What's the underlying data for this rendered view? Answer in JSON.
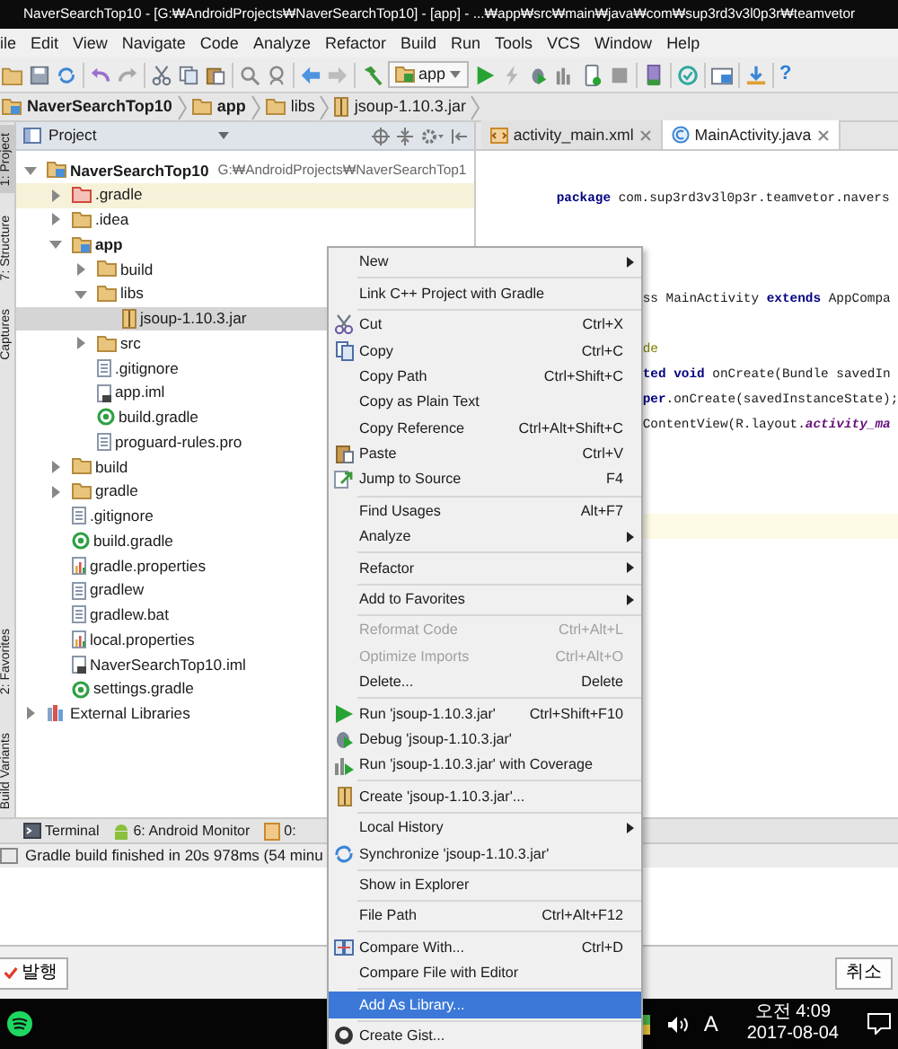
{
  "window": {
    "title": "NaverSearchTop10 - [G:₩AndroidProjects₩NaverSearchTop10] - [app] - ...₩app₩src₩main₩java₩com₩sup3rd3v3l0p3r₩teamvetor"
  },
  "menu_bar": [
    "ile",
    "Edit",
    "View",
    "Navigate",
    "Code",
    "Analyze",
    "Refactor",
    "Build",
    "Run",
    "Tools",
    "VCS",
    "Window",
    "Help"
  ],
  "toolbar": {
    "run_config": "app",
    "help": "?"
  },
  "breadcrumb": [
    "NaverSearchTop10",
    "app",
    "libs",
    "jsoup-1.10.3.jar"
  ],
  "side_tabs": [
    {
      "label": "1: Project",
      "selected": true
    },
    {
      "label": "7: Structure",
      "selected": false
    },
    {
      "label": "Captures",
      "selected": false
    },
    {
      "label": "2: Favorites",
      "selected": false
    },
    {
      "label": "Build Variants",
      "selected": false
    }
  ],
  "project_panel": {
    "view": "Project",
    "tree": [
      {
        "label": "NaverSearchTop10",
        "path": "G:₩AndroidProjects₩NaverSearchTop1",
        "kind": "module",
        "expanded": true,
        "selected": false,
        "highlighted": false,
        "children": [
          {
            "label": ".gradle",
            "kind": "excluded_folder",
            "expanded": false,
            "selected": false,
            "highlighted": true
          },
          {
            "label": ".idea",
            "kind": "folder",
            "expanded": false,
            "selected": false,
            "highlighted": false
          },
          {
            "label": "app",
            "kind": "module",
            "expanded": true,
            "selected": false,
            "highlighted": false,
            "children": [
              {
                "label": "build",
                "kind": "folder",
                "expanded": false,
                "selected": false,
                "highlighted": false
              },
              {
                "label": "libs",
                "kind": "folder",
                "expanded": true,
                "selected": false,
                "highlighted": false,
                "children": [
                  {
                    "label": "jsoup-1.10.3.jar",
                    "kind": "jar",
                    "selected": true,
                    "highlighted": false
                  }
                ]
              },
              {
                "label": "src",
                "kind": "folder",
                "expanded": false,
                "selected": false,
                "highlighted": false
              },
              {
                "label": ".gitignore",
                "kind": "text",
                "selected": false,
                "highlighted": false
              },
              {
                "label": "app.iml",
                "kind": "iml",
                "selected": false,
                "highlighted": false
              },
              {
                "label": "build.gradle",
                "kind": "gradle",
                "selected": false,
                "highlighted": false
              },
              {
                "label": "proguard-rules.pro",
                "kind": "text",
                "selected": false,
                "highlighted": false
              }
            ]
          },
          {
            "label": "build",
            "kind": "folder",
            "expanded": false,
            "selected": false,
            "highlighted": false
          },
          {
            "label": "gradle",
            "kind": "folder",
            "expanded": false,
            "selected": false,
            "highlighted": false
          },
          {
            "label": ".gitignore",
            "kind": "text",
            "selected": false,
            "highlighted": false
          },
          {
            "label": "build.gradle",
            "kind": "gradle",
            "selected": false,
            "highlighted": false
          },
          {
            "label": "gradle.properties",
            "kind": "properties",
            "selected": false,
            "highlighted": false
          },
          {
            "label": "gradlew",
            "kind": "text",
            "selected": false,
            "highlighted": false
          },
          {
            "label": "gradlew.bat",
            "kind": "text",
            "selected": false,
            "highlighted": false
          },
          {
            "label": "local.properties",
            "kind": "properties",
            "selected": false,
            "highlighted": false
          },
          {
            "label": "NaverSearchTop10.iml",
            "kind": "iml",
            "selected": false,
            "highlighted": false
          },
          {
            "label": "settings.gradle",
            "kind": "gradle",
            "selected": false,
            "highlighted": false
          }
        ]
      },
      {
        "label": "External Libraries",
        "kind": "libraries",
        "expanded": false,
        "selected": false,
        "highlighted": false
      }
    ]
  },
  "editor": {
    "tabs": [
      {
        "label": "activity_main.xml",
        "kind": "xml",
        "selected": false
      },
      {
        "label": "MainActivity.java",
        "kind": "class",
        "selected": true
      }
    ],
    "lines": [
      {
        "partly_hidden": false,
        "current": false,
        "tokens": [
          {
            "kind": "keyword",
            "text": "package"
          },
          {
            "kind": "plain",
            "text": " com.sup3rd3v3l0p3r.teamvetor.navers"
          }
        ]
      },
      {
        "current": false
      },
      {
        "current": false
      },
      {
        "current": false
      },
      {
        "partly_hidden": true,
        "current": false,
        "tokens": [
          {
            "kind": "plain",
            "text": "ss MainActivity "
          },
          {
            "kind": "keyword",
            "text": "extends"
          },
          {
            "kind": "plain",
            "text": " AppCompa"
          }
        ]
      },
      {
        "current": false
      },
      {
        "partly_hidden": true,
        "current": false,
        "tokens": [
          {
            "kind": "annotation",
            "text": "de"
          }
        ]
      },
      {
        "partly_hidden": true,
        "current": false,
        "tokens": [
          {
            "kind": "keyword",
            "text": "ted void"
          },
          {
            "kind": "plain",
            "text": " onCreate(Bundle savedIn"
          }
        ]
      },
      {
        "partly_hidden": true,
        "current": false,
        "tokens": [
          {
            "kind": "keyword",
            "text": "per"
          },
          {
            "kind": "plain",
            "text": ".onCreate(savedInstanceState);"
          }
        ]
      },
      {
        "partly_hidden": true,
        "current": false,
        "tokens": [
          {
            "kind": "plain",
            "text": "ContentView(R.layout."
          },
          {
            "kind": "field",
            "text": "activity_ma"
          }
        ]
      },
      {
        "current": false
      },
      {
        "current": false
      },
      {
        "current": false
      },
      {
        "current": true
      }
    ]
  },
  "tool_tabs": [
    "Terminal",
    "6: Android Monitor",
    "0:"
  ],
  "status_bar": "Gradle build finished in 20s 978ms (54 minu",
  "context_menu": {
    "items": [
      {
        "kind": "item",
        "label": "New",
        "submenu": true,
        "disabled": false,
        "selected": false
      },
      {
        "kind": "separator"
      },
      {
        "kind": "item",
        "label": "Link C++ Project with Gradle",
        "submenu": false,
        "disabled": false,
        "selected": false
      },
      {
        "kind": "separator"
      },
      {
        "kind": "item",
        "label": "Cut",
        "shortcut": "Ctrl+X",
        "submenu": false,
        "disabled": false,
        "selected": false
      },
      {
        "kind": "item",
        "label": "Copy",
        "shortcut": "Ctrl+C",
        "submenu": false,
        "disabled": false,
        "selected": false
      },
      {
        "kind": "item",
        "label": "Copy Path",
        "shortcut": "Ctrl+Shift+C",
        "submenu": false,
        "disabled": false,
        "selected": false
      },
      {
        "kind": "item",
        "label": "Copy as Plain Text",
        "submenu": false,
        "disabled": false,
        "selected": false
      },
      {
        "kind": "item",
        "label": "Copy Reference",
        "shortcut": "Ctrl+Alt+Shift+C",
        "submenu": false,
        "disabled": false,
        "selected": false
      },
      {
        "kind": "item",
        "label": "Paste",
        "shortcut": "Ctrl+V",
        "submenu": false,
        "disabled": false,
        "selected": false
      },
      {
        "kind": "item",
        "label": "Jump to Source",
        "shortcut": "F4",
        "submenu": false,
        "disabled": false,
        "selected": false
      },
      {
        "kind": "separator"
      },
      {
        "kind": "item",
        "label": "Find Usages",
        "shortcut": "Alt+F7",
        "submenu": false,
        "disabled": false,
        "selected": false
      },
      {
        "kind": "item",
        "label": "Analyze",
        "submenu": true,
        "disabled": false,
        "selected": false
      },
      {
        "kind": "separator"
      },
      {
        "kind": "item",
        "label": "Refactor",
        "submenu": true,
        "disabled": false,
        "selected": false
      },
      {
        "kind": "separator"
      },
      {
        "kind": "item",
        "label": "Add to Favorites",
        "submenu": true,
        "disabled": false,
        "selected": false
      },
      {
        "kind": "separator"
      },
      {
        "kind": "item",
        "label": "Reformat Code",
        "shortcut": "Ctrl+Alt+L",
        "submenu": false,
        "disabled": true,
        "selected": false
      },
      {
        "kind": "item",
        "label": "Optimize Imports",
        "shortcut": "Ctrl+Alt+O",
        "submenu": false,
        "disabled": true,
        "selected": false
      },
      {
        "kind": "item",
        "label": "Delete...",
        "shortcut": "Delete",
        "submenu": false,
        "disabled": false,
        "selected": false
      },
      {
        "kind": "separator"
      },
      {
        "kind": "item",
        "label": "Run 'jsoup-1.10.3.jar'",
        "shortcut": "Ctrl+Shift+F10",
        "submenu": false,
        "disabled": false,
        "selected": false
      },
      {
        "kind": "item",
        "label": "Debug 'jsoup-1.10.3.jar'",
        "submenu": false,
        "disabled": false,
        "selected": false
      },
      {
        "kind": "item",
        "label": "Run 'jsoup-1.10.3.jar' with Coverage",
        "submenu": false,
        "disabled": false,
        "selected": false
      },
      {
        "kind": "separator"
      },
      {
        "kind": "item",
        "label": "Create 'jsoup-1.10.3.jar'...",
        "submenu": false,
        "disabled": false,
        "selected": false
      },
      {
        "kind": "separator"
      },
      {
        "kind": "item",
        "label": "Local History",
        "submenu": true,
        "disabled": false,
        "selected": false
      },
      {
        "kind": "item",
        "label": "Synchronize 'jsoup-1.10.3.jar'",
        "submenu": false,
        "disabled": false,
        "selected": false
      },
      {
        "kind": "separator"
      },
      {
        "kind": "item",
        "label": "Show in Explorer",
        "submenu": false,
        "disabled": false,
        "selected": false
      },
      {
        "kind": "separator"
      },
      {
        "kind": "item",
        "label": "File Path",
        "shortcut": "Ctrl+Alt+F12",
        "submenu": false,
        "disabled": false,
        "selected": false
      },
      {
        "kind": "separator"
      },
      {
        "kind": "item",
        "label": "Compare With...",
        "shortcut": "Ctrl+D",
        "submenu": false,
        "disabled": false,
        "selected": false
      },
      {
        "kind": "item",
        "label": "Compare File with Editor",
        "submenu": false,
        "disabled": false,
        "selected": false
      },
      {
        "kind": "separator"
      },
      {
        "kind": "item",
        "label": "Add As Library...",
        "submenu": false,
        "disabled": false,
        "selected": true
      },
      {
        "kind": "separator"
      },
      {
        "kind": "item",
        "label": "Create Gist...",
        "submenu": false,
        "disabled": false,
        "selected": false
      }
    ]
  },
  "dialog_buttons": [
    "발행",
    "취소"
  ],
  "taskbar": {
    "input_mode": "A",
    "time": "오전 4:09",
    "date": "2017-08-04"
  }
}
